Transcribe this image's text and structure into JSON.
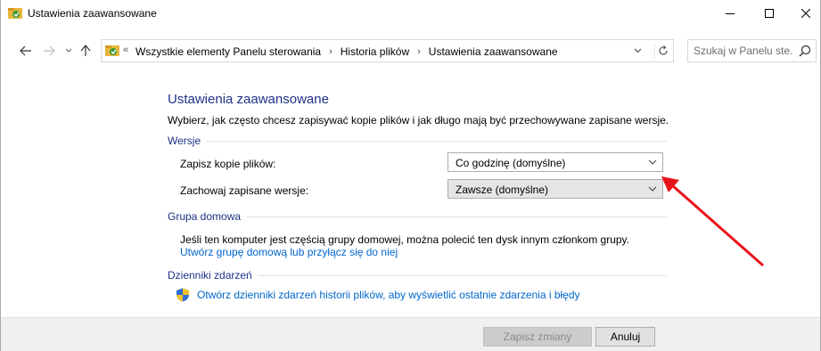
{
  "window": {
    "title": "Ustawienia zaawansowane",
    "controls": {
      "minimize": "minimize-icon",
      "maximize": "maximize-icon",
      "close": "close-icon"
    }
  },
  "navigation": {
    "back": "back-arrow-icon",
    "forward": "forward-arrow-icon",
    "recent": "chevron-down-icon",
    "up": "up-arrow-icon",
    "overflow_marker": "«",
    "breadcrumbs": [
      "Wszystkie elementy Panelu sterowania",
      "Historia plików",
      "Ustawienia zaawansowane"
    ],
    "separator": "›",
    "search_placeholder": "Szukaj w Panelu ste..."
  },
  "content": {
    "heading": "Ustawienia zaawansowane",
    "intro": "Wybierz, jak często chcesz zapisywać kopie plików i jak długo mają być przechowywane zapisane wersje.",
    "versions": {
      "label": "Wersje",
      "save_copies_label": "Zapisz kopie plików:",
      "save_copies_value": "Co godzinę (domyślne)",
      "keep_versions_label": "Zachowaj zapisane wersje:",
      "keep_versions_value": "Zawsze (domyślne)"
    },
    "homegroup": {
      "label": "Grupa domowa",
      "text": "Jeśli ten komputer jest częścią grupy domowej, można polecić ten dysk innym członkom grupy.",
      "link": "Utwórz grupę domową lub przyłącz się do niej"
    },
    "eventlogs": {
      "label": "Dzienniki zdarzeń",
      "link": "Otwórz dzienniki zdarzeń historii plików, aby wyświetlić ostatnie zdarzenia i błędy"
    }
  },
  "footer": {
    "save_label": "Zapisz zmiany",
    "cancel_label": "Anuluj"
  },
  "colors": {
    "heading": "#1e3287",
    "link": "#0066cc",
    "annotation_arrow": "#e8141b"
  }
}
